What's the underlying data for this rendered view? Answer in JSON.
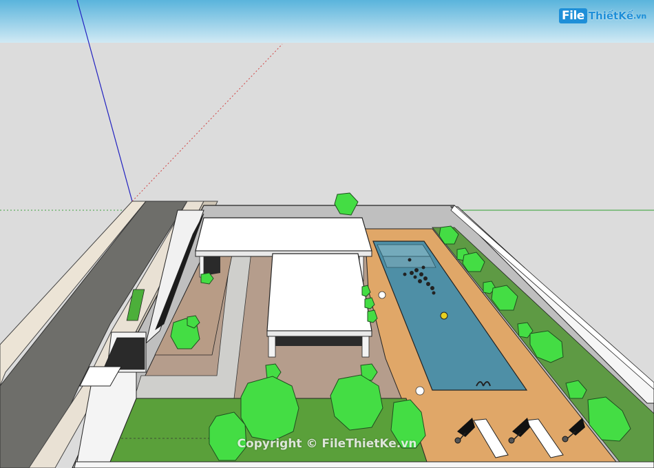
{
  "logo": {
    "brand_file": "File",
    "brand_rest": "ThiếtKế",
    "brand_tld": ".vn"
  },
  "watermark": {
    "text": "Copyright © FileThietKe.vn"
  },
  "colors": {
    "sky_top": "#62b8de",
    "ground": "#dcdcdc",
    "street": "#6e6e6a",
    "sidewalk": "#e9e1d4",
    "lawn": "#5aa03a",
    "paving": "#b59d8c",
    "pool_deck": "#e0a768",
    "pool_water": "#4e8fa6",
    "roof": "#ffffff",
    "tree": "#44dd44",
    "wall": "#f4f4f4"
  }
}
